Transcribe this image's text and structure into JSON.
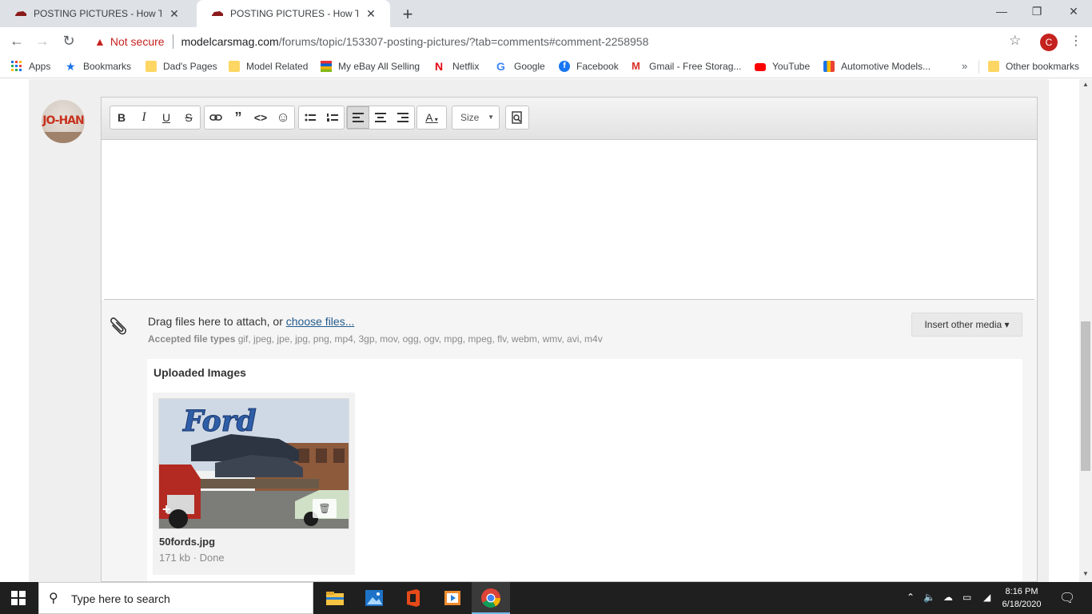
{
  "tabs": [
    {
      "title": "POSTING PICTURES - How To Use",
      "close": "✕"
    },
    {
      "title": "POSTING PICTURES - How To Use",
      "close": "✕"
    }
  ],
  "new_tab": "+",
  "window": {
    "minimize": "—",
    "restore": "❐",
    "close": "✕"
  },
  "nav": {
    "back": "←",
    "forward": "→",
    "reload": "↻"
  },
  "address": {
    "warning": "Not secure",
    "host": "modelcarsmag.com",
    "path": "/forums/topic/153307-posting-pictures/?tab=comments#comment-2258958"
  },
  "profile_initial": "C",
  "bookmarks": [
    {
      "label": "Apps",
      "icon": "apps-grid-icon"
    },
    {
      "label": "Bookmarks",
      "icon": "star-icon"
    },
    {
      "label": "Dad's Pages",
      "icon": "folder-icon"
    },
    {
      "label": "Model Related",
      "icon": "folder-icon"
    },
    {
      "label": "My eBay All Selling",
      "icon": "ebay-icon"
    },
    {
      "label": "Netflix",
      "icon": "netflix-icon"
    },
    {
      "label": "Google",
      "icon": "google-icon"
    },
    {
      "label": "Facebook",
      "icon": "facebook-icon"
    },
    {
      "label": "Gmail - Free Storag...",
      "icon": "gmail-icon"
    },
    {
      "label": "YouTube",
      "icon": "youtube-icon"
    },
    {
      "label": "Automotive Models...",
      "icon": "automotive-icon"
    }
  ],
  "bookmarks_overflow": "»",
  "other_bookmarks": "Other bookmarks",
  "user_avatar_text": "JO-HAN",
  "editor": {
    "toolbar": {
      "bold": "B",
      "italic": "I",
      "underline": "U",
      "strike": "S",
      "link": "🔗",
      "quote": "❞",
      "code": "<>",
      "emoji": "☺",
      "bullets": "☰",
      "numbers": "☷",
      "align_left": "≡",
      "align_center": "≡",
      "align_right": "≡",
      "color": "A",
      "size": "Size",
      "preview": "🔍"
    },
    "attach": {
      "drag_text": "Drag files here to attach, or ",
      "choose_link": "choose files...",
      "accepted_label": "Accepted file types",
      "accepted_types": " gif, jpeg, jpe, jpg, png, mp4, 3gp, mov, ogg, ogv, mpg, mpeg, flv, webm, wmv, avi, m4v",
      "insert_media": "Insert other media ▾"
    },
    "uploaded": {
      "title": "Uploaded Images",
      "files": [
        {
          "name": "50fords.jpg",
          "status": "171 kb · Done",
          "sign_text": "Ford"
        }
      ]
    }
  },
  "taskbar": {
    "search_placeholder": "Type here to search",
    "time": "8:16 PM",
    "date": "6/18/2020"
  },
  "colors": {
    "tab_strip": "#dee1e6",
    "warning_red": "#c5221f",
    "link_blue": "#235a8c",
    "taskbar": "#1f1f1f"
  }
}
